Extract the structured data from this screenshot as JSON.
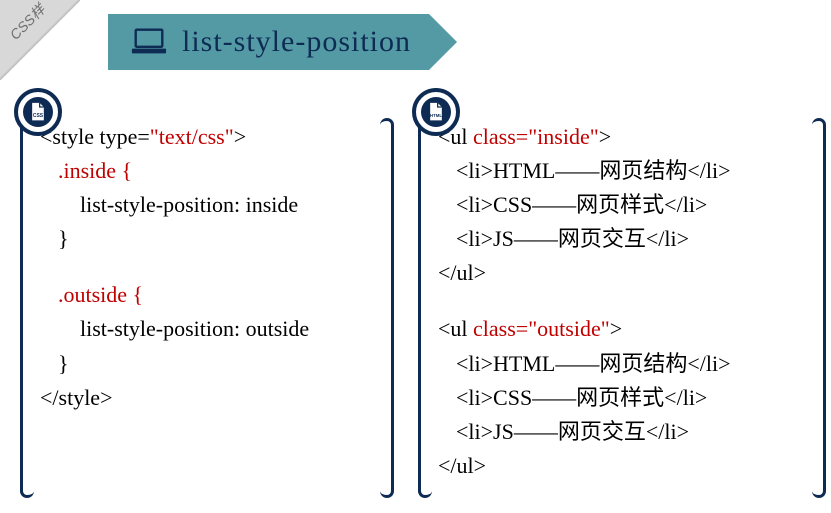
{
  "corner": {
    "text": "CSS样"
  },
  "title": {
    "label": "list-style-position"
  },
  "badges": {
    "css_label": "CSS",
    "html_label": "HTML"
  },
  "css_code": {
    "l1_a": "<style type=",
    "l1_b": "\"text/css\"",
    "l1_c": ">",
    "l2": ".inside {",
    "l3": "list-style-position: inside",
    "l4": "}",
    "l5": ".outside {",
    "l6": "list-style-position: outside",
    "l7": "}",
    "l8": "</style>"
  },
  "html_code": {
    "u1_a": "<ul ",
    "u1_b": "class=\"inside\"",
    "u1_c": ">",
    "li1": "<li>HTML——网页结构</li>",
    "li2": "<li>CSS——网页样式</li>",
    "li3": "<li>JS——网页交互</li>",
    "u1_end": "</ul>",
    "u2_a": "<ul ",
    "u2_b": "class=\"outside\"",
    "u2_c": ">",
    "li4": "<li>HTML——网页结构</li>",
    "li5": "<li>CSS——网页样式</li>",
    "li6": "<li>JS——网页交互</li>",
    "u2_end": "</ul>"
  }
}
